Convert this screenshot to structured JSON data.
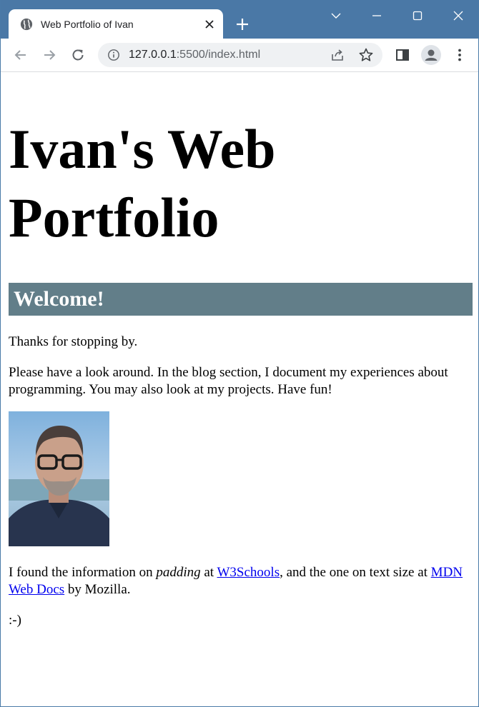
{
  "browser": {
    "tab_title": "Web Portfolio of Ivan",
    "url_host": "127.0.0.1",
    "url_rest": ":5500/index.html",
    "accent_color": "#4a78a6"
  },
  "page": {
    "heading_line1": "Ivan's Web",
    "heading_line2": "Portfolio",
    "welcome": "Welcome!",
    "welcome_bg": "#627e89",
    "para1": "Thanks for stopping by.",
    "para2": "Please have a look around. In the blog section, I document my experiences about programming. You may also look at my projects. Have fun!",
    "para3_a": "I found the information on ",
    "para3_em": "padding",
    "para3_b": " at ",
    "link_w3": "W3Schools",
    "para3_c": ", and the one on text size at ",
    "link_mdn": "MDN Web Docs",
    "para3_d": " by Mozilla.",
    "para4": ":-)"
  }
}
